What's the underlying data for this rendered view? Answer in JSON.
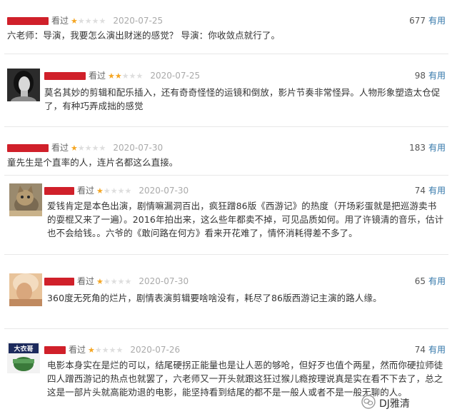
{
  "vote_label": "有用",
  "watched_label": "看过",
  "reviews": [
    {
      "date": "2020-07-25",
      "rating": 1,
      "votes": "677",
      "text": "六老师：导演，我要怎么演出财迷的感觉？ 导演：你收敛点就行了。",
      "avatar": null
    },
    {
      "date": "2020-07-25",
      "rating": 2,
      "votes": "98",
      "text": "莫名其妙的剪辑和配乐插入，还有奇奇怪怪的运镜和倒放，影片节奏非常怪异。人物形象塑造太仓促了，有种巧弄成拙的感觉",
      "avatar": "woman-portrait-avatar"
    },
    {
      "date": "2020-07-30",
      "rating": 1,
      "votes": "183",
      "text": "童先生是个直率的人，连片名都这么直接。",
      "avatar": null
    },
    {
      "date": "2020-07-30",
      "rating": 1,
      "votes": "74",
      "text": "爱钱肯定是本色出演，剧情嘛漏洞百出，疯狂蹭86版《西游记》的热度（开场彩蛋就是把巡游卖书的耍棍又来了一遍）。2016年拍出来，这么些年都卖不掉，可见品质如何。用了许镜清的音乐，估计也不会给钱。。六爷的《敢问路在何方》看来开花难了，情怀消耗得差不多了。",
      "avatar": "cat-avatar"
    },
    {
      "date": "2020-07-30",
      "rating": 1,
      "votes": "65",
      "text": "360度无死角的烂片，剧情表演剪辑要啥啥没有，耗尽了86版西游记主演的路人缘。",
      "avatar": "blurred-face-avatar"
    },
    {
      "date": "2020-07-26",
      "rating": 1,
      "votes": "74",
      "text": "电影本身实在是烂的可以，结尾硬拐正能量也是让人恶的够呛，但好歹也值个两星，然而你硬拉师徒四人蹭西游记的热点也就罢了，六老师又一开头就跟这狂过猴儿瘾按理说真是实在看不下去了，总之这是一部片头就高能劝退的电影，能坚持看到结尾的都不是一般人或者不是一般无聊的人。",
      "avatar": "logo-avatar",
      "avatar_caption": "大衣哥"
    }
  ],
  "watermark": {
    "text": "DJ雅清",
    "icon": "wechat-icon"
  },
  "colors": {
    "star": "#f5a623",
    "useful_link": "#3377aa",
    "name_redaction": "#d0202a"
  }
}
